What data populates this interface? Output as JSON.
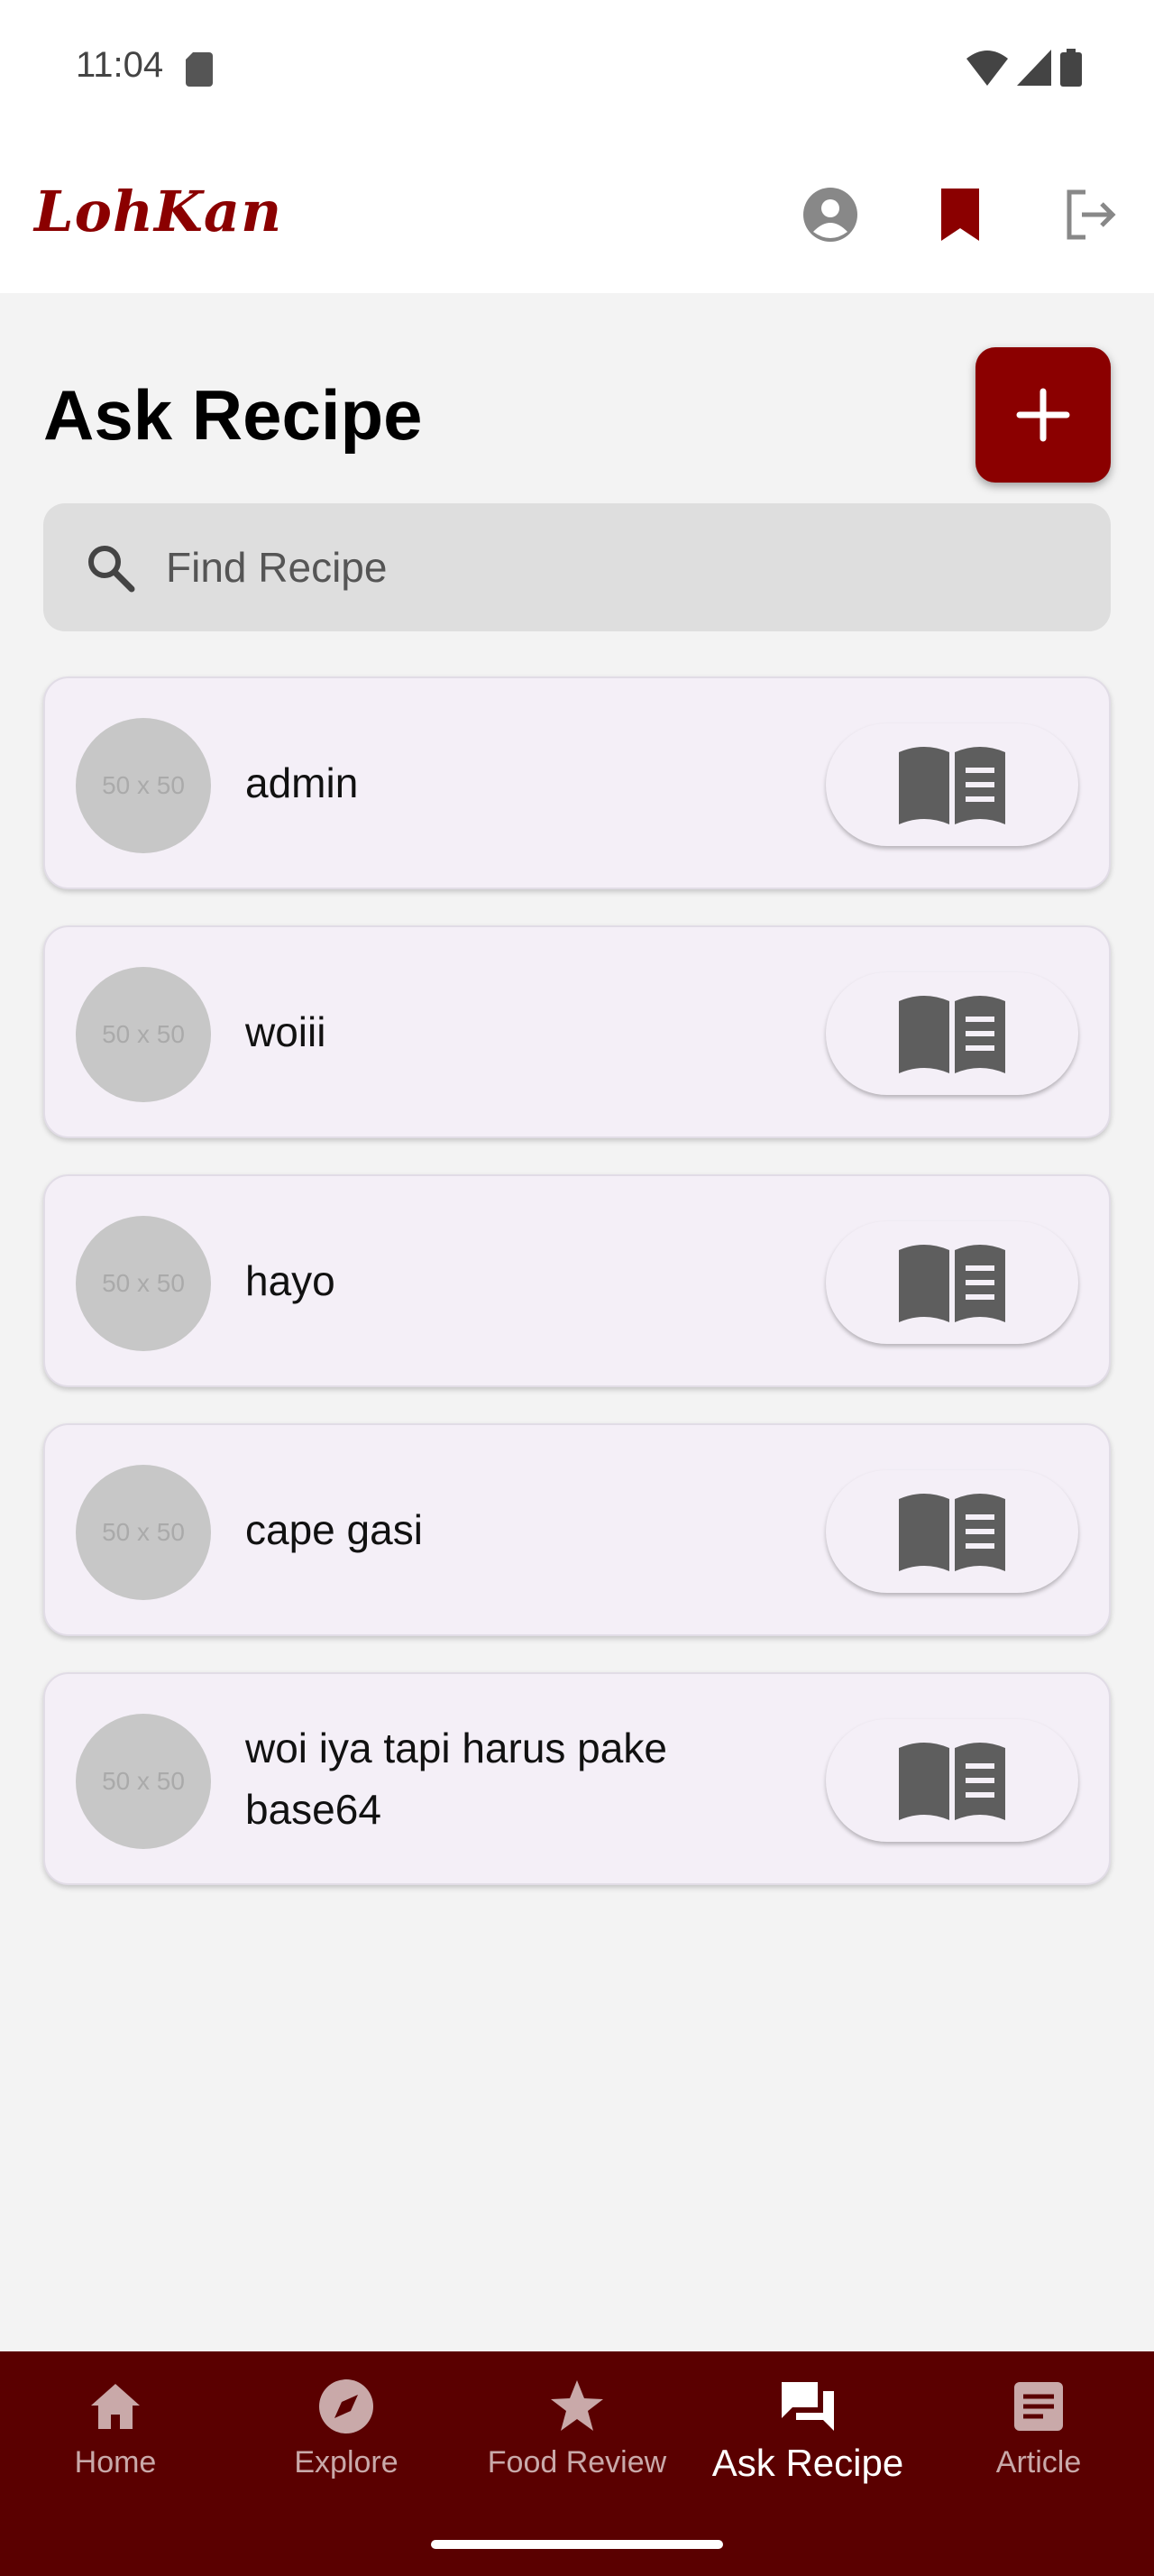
{
  "status_bar": {
    "time": "11:04"
  },
  "app_bar": {
    "logo": "LohKan"
  },
  "page": {
    "title": "Ask Recipe",
    "search": {
      "placeholder": "Find Recipe",
      "value": ""
    }
  },
  "avatar_placeholder": "50 x 50",
  "recipes": [
    {
      "title": "admin"
    },
    {
      "title": "woiii"
    },
    {
      "title": "hayo"
    },
    {
      "title": "cape gasi"
    },
    {
      "title": "woi iya tapi harus pake base64"
    }
  ],
  "bottom_nav": {
    "items": [
      {
        "label": "Home",
        "icon": "home-icon"
      },
      {
        "label": "Explore",
        "icon": "compass-icon"
      },
      {
        "label": "Food Review",
        "icon": "star-icon"
      },
      {
        "label": "Ask Recipe",
        "icon": "chat-icon",
        "active": true
      },
      {
        "label": "Article",
        "icon": "article-icon"
      }
    ]
  },
  "colors": {
    "primary": "#8b0000",
    "nav_background": "#5a0000",
    "card_background": "#f4eff7"
  }
}
